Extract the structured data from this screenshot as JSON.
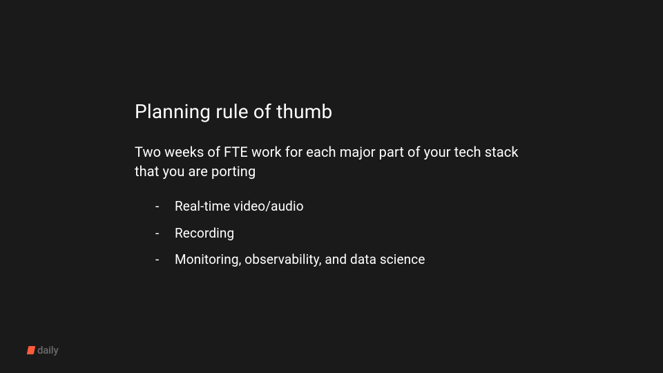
{
  "slide": {
    "title": "Planning rule of thumb",
    "subtitle": "Two weeks of FTE work for each major part of your tech stack that you are porting",
    "bullets": [
      "Real-time video/audio",
      "Recording",
      "Monitoring, observability, and data science"
    ]
  },
  "branding": {
    "logo_text": "daily",
    "accent_color": "#ff5b3a"
  }
}
